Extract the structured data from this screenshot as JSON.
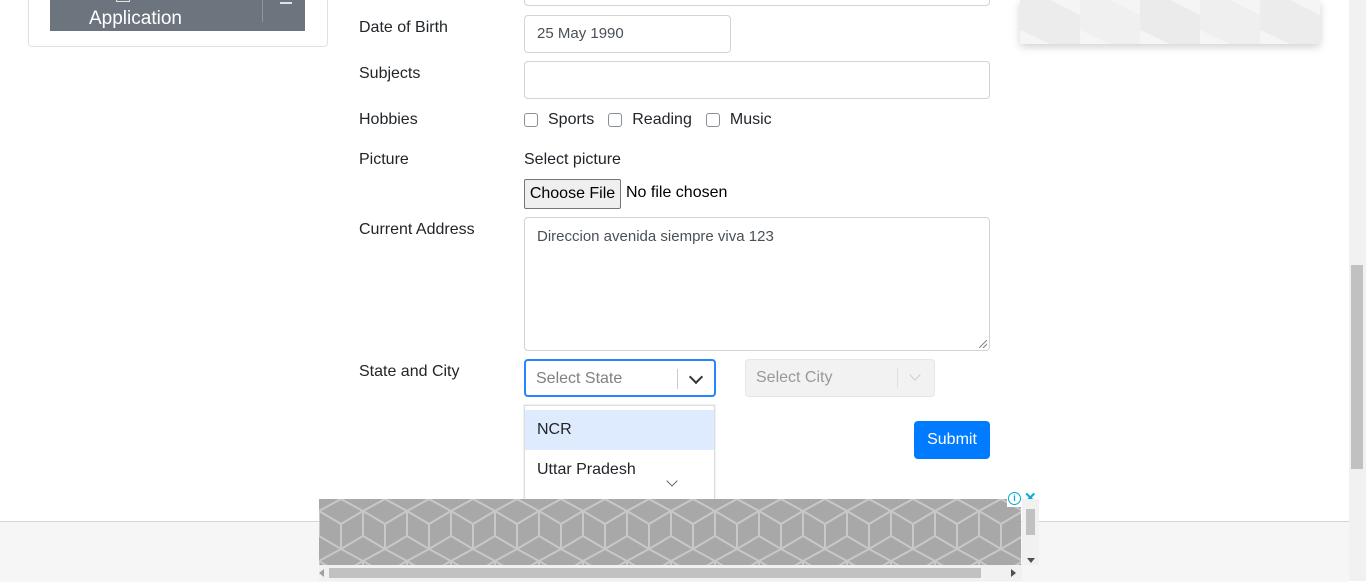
{
  "sidebar": {
    "active_item_label": "Application"
  },
  "form": {
    "dob": {
      "label": "Date of Birth",
      "value": "25 May 1990"
    },
    "subjects": {
      "label": "Subjects",
      "value": ""
    },
    "hobbies": {
      "label": "Hobbies",
      "options": [
        {
          "label": "Sports",
          "checked": false
        },
        {
          "label": "Reading",
          "checked": false
        },
        {
          "label": "Music",
          "checked": false
        }
      ]
    },
    "picture": {
      "label": "Picture",
      "select_text": "Select picture",
      "button": "Choose File",
      "status": "No file chosen"
    },
    "address": {
      "label": "Current Address",
      "value": "Direccion avenida siempre viva 123"
    },
    "state_city": {
      "label": "State and City",
      "state_placeholder": "Select State",
      "city_placeholder": "Select City",
      "state_options": [
        "NCR",
        "Uttar Pradesh"
      ],
      "highlighted_option": "NCR"
    },
    "submit": "Submit"
  },
  "colors": {
    "primary": "#007bff",
    "focus": "#2684ff",
    "option_highlight": "#deebff",
    "ad_accent": "#00aecd"
  },
  "icons": [
    "chevron-down-icon",
    "ad-info-icon",
    "ad-close-icon"
  ]
}
